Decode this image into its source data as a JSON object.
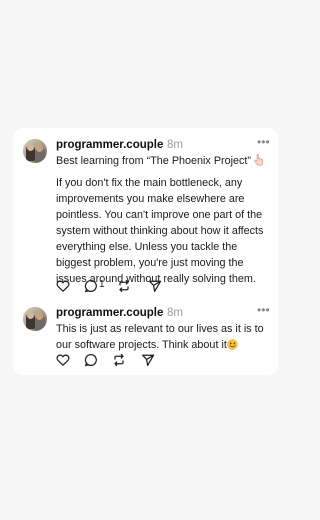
{
  "posts": [
    {
      "username": "programmer.couple",
      "time": "8m",
      "more": "•••",
      "title": "Best learning from “The Phoenix Project”",
      "body": "If you don't fix the main bottleneck, any improvements you make elsewhere are pointless. You can't improve one part of the system without thinking about how it affects everything else. Unless you tackle the biggest problem, you're just moving the issues around without really solving them.",
      "reply_count": "1",
      "icons": [
        "heart-icon",
        "comment-icon",
        "repost-icon",
        "send-icon"
      ]
    },
    {
      "username": "programmer.couple",
      "time": "8m",
      "more": "•••",
      "body": "This is just as relevant to our lives as it is to our software projects. Think about it",
      "icons": [
        "heart-icon",
        "comment-icon",
        "repost-icon",
        "send-icon"
      ]
    }
  ],
  "colors": {
    "background": "#f7f7f7",
    "card": "#ffffff",
    "text": "#1b1b1b",
    "muted": "#9a9a9a"
  }
}
